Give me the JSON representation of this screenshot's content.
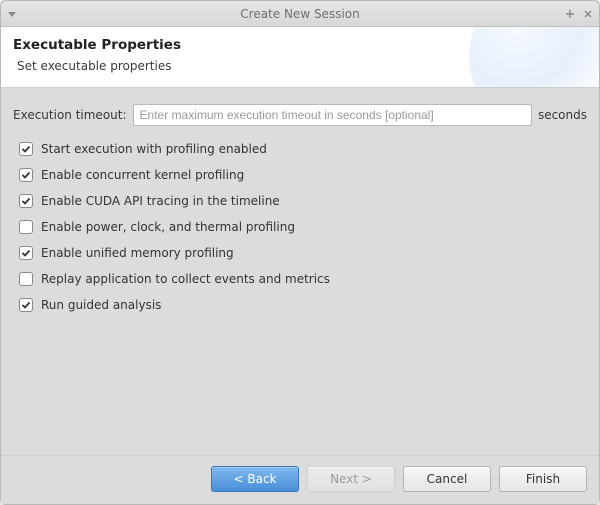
{
  "window": {
    "title": "Create New Session"
  },
  "header": {
    "title": "Executable Properties",
    "subtitle": "Set executable properties"
  },
  "timeout": {
    "label": "Execution timeout:",
    "value": "",
    "placeholder": "Enter maximum execution timeout in seconds [optional]",
    "suffix": "seconds"
  },
  "options": [
    {
      "label": "Start execution with profiling enabled",
      "checked": true
    },
    {
      "label": "Enable concurrent kernel profiling",
      "checked": true
    },
    {
      "label": "Enable CUDA API tracing in the timeline",
      "checked": true
    },
    {
      "label": "Enable power, clock, and thermal profiling",
      "checked": false
    },
    {
      "label": "Enable unified memory profiling",
      "checked": true
    },
    {
      "label": "Replay application to collect events and metrics",
      "checked": false
    },
    {
      "label": "Run guided analysis",
      "checked": true
    }
  ],
  "buttons": {
    "back": "< Back",
    "next": "Next >",
    "cancel": "Cancel",
    "finish": "Finish"
  }
}
